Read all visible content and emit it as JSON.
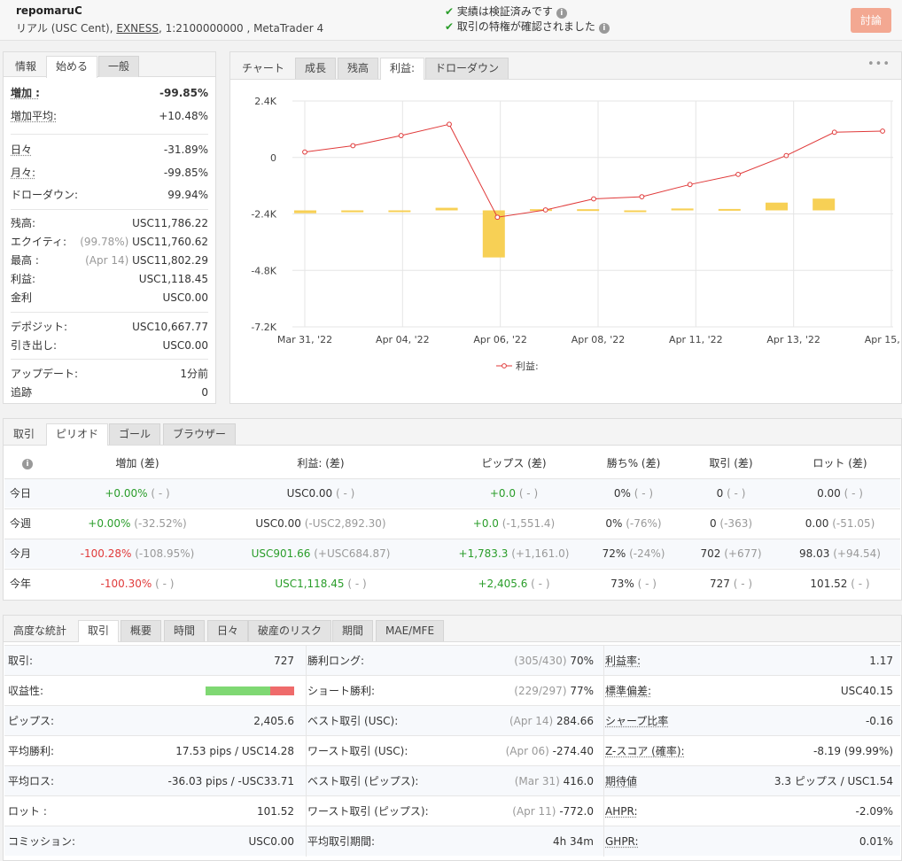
{
  "header": {
    "account_name": "repomaruC",
    "account_desc_prefix": "リアル (USC Cent), ",
    "broker": "EXNESS",
    "account_desc_suffix": ", 1:2100000000 , MetaTrader 4",
    "verified_1": "実績は検証済みです",
    "verified_2": "取引の特権が確認されました",
    "discuss_button": "討論"
  },
  "left_panel": {
    "tabs": [
      "情報",
      "始める",
      "一般"
    ],
    "rows": {
      "gain_label": "増加 :",
      "gain_value": "-99.85%",
      "avg_gain_label": "増加平均:",
      "avg_gain_value": "+10.48%",
      "daily_label": "日々",
      "daily_value": "-31.89%",
      "monthly_label": "月々:",
      "monthly_value": "-99.85%",
      "drawdown_label": "ドローダウン:",
      "drawdown_value": "99.94%",
      "balance_label": "残高:",
      "balance_value": "USC11,786.22",
      "equity_label": "エクイティ:",
      "equity_note": "(99.78%)",
      "equity_value": "USC11,760.62",
      "highest_label": "最高 :",
      "highest_note": "(Apr 14)",
      "highest_value": "USC11,802.29",
      "profit_label": "利益:",
      "profit_value": "USC1,118.45",
      "interest_label": "金利",
      "interest_value": "USC0.00",
      "deposits_label": "デポジット:",
      "deposits_value": "USC10,667.77",
      "withdrawals_label": "引き出し:",
      "withdrawals_value": "USC0.00",
      "updated_label": "アップデート:",
      "updated_value": "1分前",
      "tracking_label": "追跡",
      "tracking_value": "0"
    }
  },
  "chart_panel": {
    "tabs": [
      "チャート",
      "成長",
      "残高",
      "利益:",
      "ドローダウン"
    ],
    "menu_glyph": "•••"
  },
  "chart_data": {
    "type": "line",
    "legend_entry": "利益:",
    "legend_placement": "bottom",
    "ylim": [
      -7200,
      2400
    ],
    "yticks": [
      2400,
      0,
      -2400,
      -4800,
      -7200
    ],
    "ytick_labels": [
      "2.4K",
      "0",
      "-2.4K",
      "-4.8K",
      "-7.2K"
    ],
    "xtick_labels": [
      "Mar 31, '22",
      "Apr 04, '22",
      "Apr 06, '22",
      "Apr 08, '22",
      "Apr 11, '22",
      "Apr 13, '22",
      "Apr 15, '22"
    ],
    "line_values": [
      230,
      500,
      930,
      1410,
      -2540,
      -2230,
      -1760,
      -1670,
      -1150,
      -720,
      80,
      1070,
      1120
    ],
    "bar_values": [
      -120,
      -80,
      -40,
      110,
      -2000,
      50,
      50,
      -20,
      80,
      60,
      330,
      500
    ],
    "grid": true,
    "line_color": "#e03a3a",
    "bar_color": "#f7d055"
  },
  "period_panel": {
    "tabs": [
      "取引",
      "ピリオド",
      "ゴール",
      "ブラウザー"
    ],
    "columns": [
      "増加 (差)",
      "利益: (差)",
      "ピップス (差)",
      "勝ち% (差)",
      "取引 (差)",
      "ロット (差)"
    ],
    "rows": [
      {
        "label": "今日",
        "gain": "+0.00%",
        "gain_d": "( - )",
        "profit": "USC0.00",
        "profit_d": "( - )",
        "pips": "+0.0",
        "pips_d": "( - )",
        "win": "0%",
        "win_d": "( - )",
        "trades": "0",
        "trades_d": "( - )",
        "lots": "0.00",
        "lots_d": "( - )"
      },
      {
        "label": "今週",
        "gain": "+0.00%",
        "gain_d": "(-32.52%)",
        "profit": "USC0.00",
        "profit_d": "(-USC2,892.30)",
        "pips": "+0.0",
        "pips_d": "(-1,551.4)",
        "win": "0%",
        "win_d": "(-76%)",
        "trades": "0",
        "trades_d": "(-363)",
        "lots": "0.00",
        "lots_d": "(-51.05)"
      },
      {
        "label": "今月",
        "gain": "-100.28%",
        "gain_d": "(-108.95%)",
        "profit": "USC901.66",
        "profit_d": "(+USC684.87)",
        "pips": "+1,783.3",
        "pips_d": "(+1,161.0)",
        "win": "72%",
        "win_d": "(-24%)",
        "trades": "702",
        "trades_d": "(+677)",
        "lots": "98.03",
        "lots_d": "(+94.54)"
      },
      {
        "label": "今年",
        "gain": "-100.30%",
        "gain_d": "( - )",
        "profit": "USC1,118.45",
        "profit_d": "( - )",
        "pips": "+2,405.6",
        "pips_d": "( - )",
        "win": "73%",
        "win_d": "( - )",
        "trades": "727",
        "trades_d": "( - )",
        "lots": "101.52",
        "lots_d": "( - )"
      }
    ]
  },
  "stats_panel": {
    "tabs": [
      "高度な統計",
      "取引",
      "概要",
      "時間",
      "日々",
      "破産のリスク",
      "期間",
      "MAE/MFE"
    ],
    "col1": [
      {
        "label": "取引:",
        "value": "727"
      },
      {
        "label": "収益性:",
        "value": ""
      },
      {
        "label": "ピップス:",
        "value": "2,405.6"
      },
      {
        "label": "平均勝利:",
        "value": "17.53 pips / USC14.28"
      },
      {
        "label": "平均ロス:",
        "value": "-36.03 pips / -USC33.71"
      },
      {
        "label": "ロット :",
        "value": "101.52"
      },
      {
        "label": "コミッション:",
        "value": "USC0.00"
      }
    ],
    "profitability": {
      "win_fraction": 0.73
    },
    "col2": [
      {
        "label": "勝利ロング:",
        "note": "(305/430)",
        "value": "70%"
      },
      {
        "label": "ショート勝利:",
        "note": "(229/297)",
        "value": "77%"
      },
      {
        "label": "ベスト取引 (USC):",
        "note": "(Apr 14)",
        "value": "284.66"
      },
      {
        "label": "ワースト取引 (USC):",
        "note": "(Apr 06)",
        "value": "-274.40"
      },
      {
        "label": "ベスト取引 (ピップス):",
        "note": "(Mar 31)",
        "value": "416.0"
      },
      {
        "label": "ワースト取引 (ピップス):",
        "note": "(Apr 11)",
        "value": "-772.0"
      },
      {
        "label": "平均取引期間:",
        "note": "",
        "value": "4h 34m"
      }
    ],
    "col3": [
      {
        "label": "利益率:",
        "value": "1.17"
      },
      {
        "label": "標準偏差:",
        "value": "USC40.15"
      },
      {
        "label": "シャープ比率",
        "value": "-0.16"
      },
      {
        "label": "Z-スコア (確率):",
        "value": "-8.19 (99.99%)"
      },
      {
        "label": "期待値",
        "value": "3.3 ピップス / USC1.54"
      },
      {
        "label": "AHPR:",
        "value": "-2.09%"
      },
      {
        "label": "GHPR:",
        "value": "0.01%"
      }
    ]
  }
}
